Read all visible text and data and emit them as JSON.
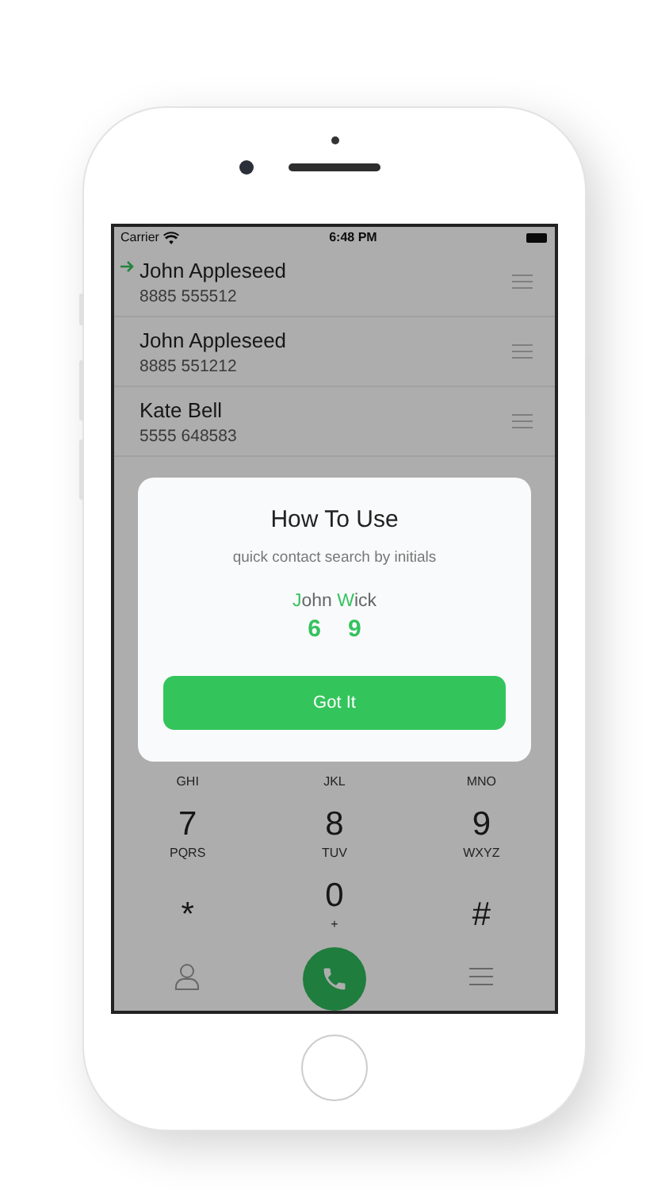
{
  "status_bar": {
    "carrier": "Carrier",
    "time": "6:48 PM"
  },
  "contacts": [
    {
      "name": "John Appleseed",
      "number": "8885 555512",
      "selected": true
    },
    {
      "name": "John Appleseed",
      "number": "8885 551212",
      "selected": false
    },
    {
      "name": "Kate Bell",
      "number": "5555 648583",
      "selected": false
    }
  ],
  "keypad": [
    [
      {
        "letters": "GHI"
      },
      {
        "letters": "JKL"
      },
      {
        "letters": "MNO"
      }
    ],
    [
      {
        "digit": "7",
        "letters": "PQRS"
      },
      {
        "digit": "8",
        "letters": "TUV"
      },
      {
        "digit": "9",
        "letters": "WXYZ"
      }
    ],
    [
      {
        "digit": "*"
      },
      {
        "digit": "0",
        "letters": "+"
      },
      {
        "digit": "#"
      }
    ]
  ],
  "dialog": {
    "title": "How To Use",
    "subtitle": "quick contact search by initials",
    "example_name": [
      {
        "text": "J",
        "highlight": true
      },
      {
        "text": "ohn ",
        "highlight": false
      },
      {
        "text": "W",
        "highlight": true
      },
      {
        "text": "ick",
        "highlight": false
      }
    ],
    "example_digits": [
      "6",
      "9"
    ],
    "button": "Got It"
  }
}
